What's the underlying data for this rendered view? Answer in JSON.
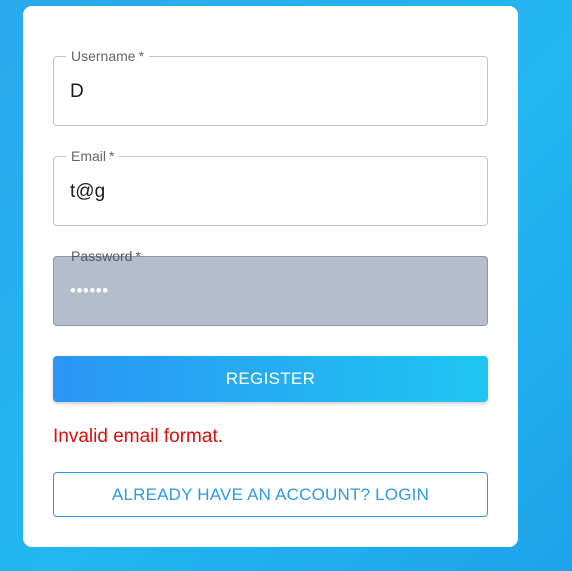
{
  "form": {
    "username": {
      "label": "Username",
      "required_mark": "*",
      "value": "D"
    },
    "email": {
      "label": "Email",
      "required_mark": "*",
      "value": "t@g"
    },
    "password": {
      "label": "Password",
      "required_mark": "*",
      "value": "••••••"
    },
    "register_label": "REGISTER",
    "error_message": "Invalid email format.",
    "login_link_label": "ALREADY HAVE AN ACCOUNT? LOGIN"
  },
  "colors": {
    "background_gradient_start": "#2aa9ee",
    "primary_button_gradient": [
      "#2b95f4",
      "#1fc6f2"
    ],
    "error_text": "#e00b0b",
    "outline_button": "#2e9ae6",
    "autofill_field": "#b5bccb"
  }
}
